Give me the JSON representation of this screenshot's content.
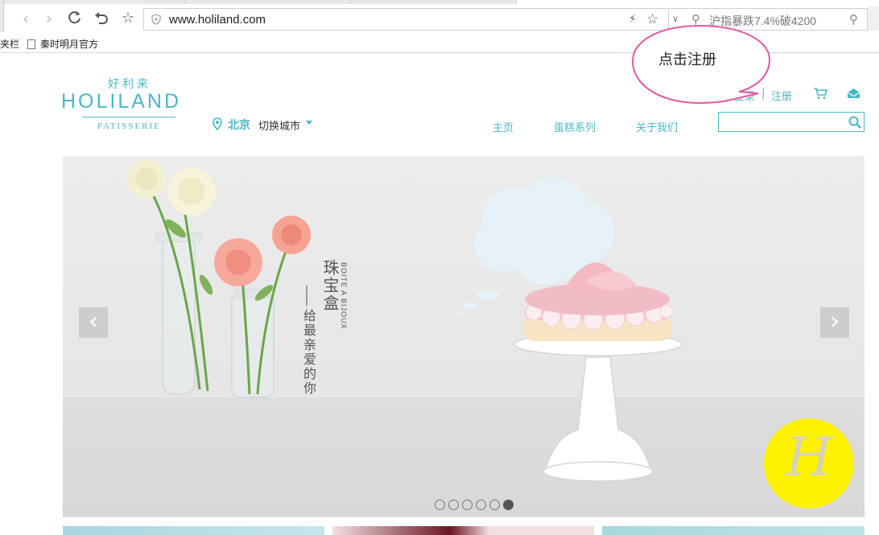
{
  "browser": {
    "url": "www.holiland.com",
    "search_text": "沪指暴跌7.4%破4200",
    "bookmarks": {
      "folder_label": "夹栏",
      "item_label": "秦时明月官方"
    }
  },
  "site": {
    "logo": {
      "cn": "好利来",
      "en": "HOLILAND",
      "sub": "PATISSERIE"
    },
    "city": {
      "name": "北京",
      "switch_label": "切换城市"
    },
    "nav": [
      {
        "label": "主页"
      },
      {
        "label": "蛋糕系列"
      },
      {
        "label": "关于我们"
      }
    ],
    "account": {
      "login": "登录",
      "separator": "|",
      "register": "注册"
    },
    "search": {
      "value": "",
      "placeholder": ""
    },
    "colors": {
      "brand": "#4ab8c8",
      "callout_border": "#e05aa0",
      "badge": "#fff200"
    }
  },
  "banner": {
    "title": "珠宝盒",
    "title_en": "BOITE A BIJOUX",
    "slogan": "给最亲爱的你",
    "dash": "——",
    "prev_arrow": "‹",
    "next_arrow": "›",
    "dots": [
      {
        "active": false
      },
      {
        "active": false
      },
      {
        "active": false
      },
      {
        "active": false
      },
      {
        "active": false
      },
      {
        "active": true
      }
    ]
  },
  "annotation": {
    "callout_text": "点击注册",
    "badge_letter": "H"
  }
}
